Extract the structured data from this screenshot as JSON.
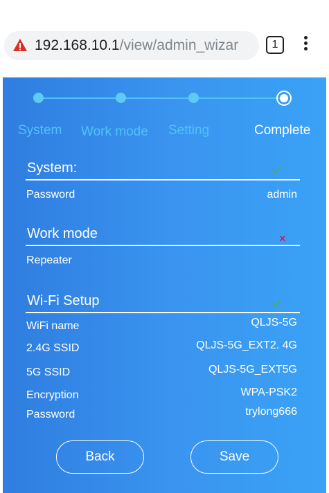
{
  "browser": {
    "url_host": "192.168.10.1",
    "url_path": "/view/admin_wizar",
    "tab_count": "1",
    "warning_icon": "warning-triangle-icon",
    "menu_icon": "more-vert-icon"
  },
  "steps": [
    {
      "label": "System",
      "state": "done"
    },
    {
      "label": "Work mode",
      "state": "done"
    },
    {
      "label": "Setting",
      "state": "done"
    },
    {
      "label": "Complete",
      "state": "active"
    }
  ],
  "sections": {
    "system": {
      "title": "System:",
      "status": "check",
      "rows": [
        {
          "label": "Password",
          "value": "admin"
        }
      ]
    },
    "work_mode": {
      "title": "Work mode",
      "status": "cross",
      "rows": [
        {
          "label": "Repeater",
          "value": ""
        }
      ]
    },
    "wifi": {
      "title": "Wi-Fi Setup",
      "status": "check",
      "rows": [
        {
          "label": "WiFi name",
          "value": "QLJS-5G"
        },
        {
          "label": "2.4G SSID",
          "value": "QLJS-5G_EXT2. 4G"
        },
        {
          "label": "5G SSID",
          "value": "QLJS-5G_EXT5G"
        },
        {
          "label": "Encryption",
          "value": "WPA-PSK2"
        },
        {
          "label": "Password",
          "value": "trylong666"
        }
      ]
    }
  },
  "buttons": {
    "back": "Back",
    "save": "Save"
  },
  "colors": {
    "panel_start": "#2f7de0",
    "panel_end": "#3aa2f6",
    "step_inactive": "#4fc3f7",
    "check": "#4caf50",
    "cross": "#c2185b"
  }
}
